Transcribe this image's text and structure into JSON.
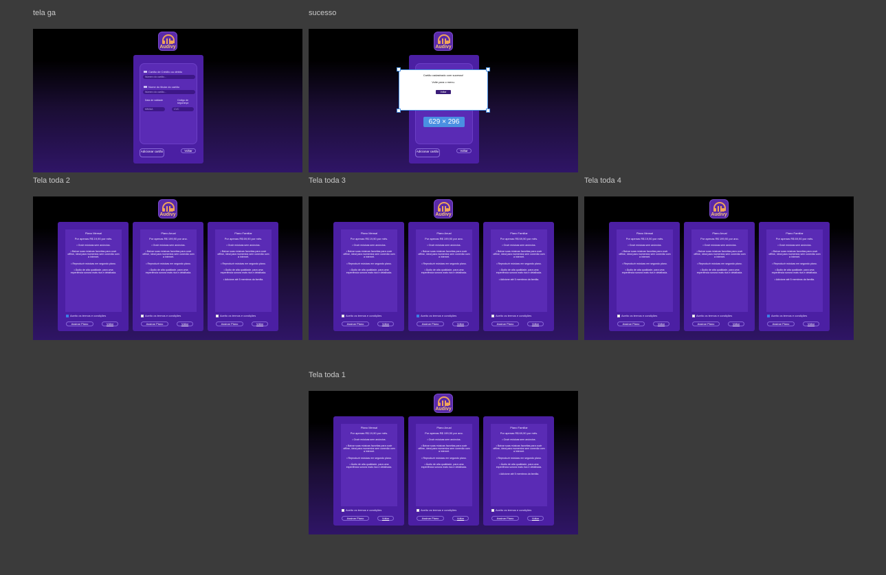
{
  "frames": {
    "tela_ga": {
      "label": "tela ga",
      "logo_text": "Audivy",
      "card_label": "Cartão de Crédito ou débito",
      "card_placeholder": "Número do cartão...",
      "holder_label": "Nome do titular do cartão",
      "holder_placeholder": "Número do cartão...",
      "expiry_label": "Data de validade",
      "expiry_placeholder": "MM/AA",
      "cvc_label": "Código de segurança",
      "cvc_placeholder": "CVC",
      "add_button": "Adicionar cartão",
      "back_button": "Voltar"
    },
    "sucesso": {
      "label": "sucesso",
      "logo_text": "Audivy",
      "modal_title": "Cartão cadastrado com sucesso!",
      "modal_subtitle": "Volte para o menu.",
      "modal_button": "Voltar",
      "size_badge": "629 × 296",
      "add_button": "Adicionar cartão",
      "back_button": "Voltar"
    },
    "plans": {
      "monthly": {
        "title": "Plano Mensal",
        "price": "Por apenas R$ 19,90 por mês.",
        "features": [
          "• Ouvir músicas sem anúncios.",
          "• Baixar suas músicas favoritas para ouvir offline, ideal para momentos sem conexão com a internet.",
          "• Reproduzir músicas em segundo plano.",
          "• Áudio de alta qualidade, para uma experiência sonora mais rica e detalhada."
        ]
      },
      "annual": {
        "title": "Plano Anual",
        "price": "Por apenas R$ 199,90 por ano.",
        "features": [
          "• Ouvir músicas sem anúncios.",
          "• Baixar suas músicas favoritas para ouvir offline, ideal para momentos sem conexão com a internet.",
          "• Reproduzir músicas em segundo plano.",
          "• Áudio de alta qualidade, para uma experiência sonora mais rica e detalhada."
        ]
      },
      "family": {
        "title": "Plano Familiar",
        "price": "Por apenas R$ 69,90 por mês.",
        "features": [
          "• Ouvir músicas sem anúncios.",
          "• Baixar suas músicas favoritas para ouvir offline, ideal para momentos sem conexão com a internet.",
          "• Reproduzir músicas em segundo plano.",
          "• Áudio de alta qualidade, para uma experiência sonora mais rica e detalhada.",
          "• Adicione até 5 membros da família."
        ]
      },
      "terms": "Aceito os termos e condições",
      "sign_button": "Assinar Plano",
      "back_button": "Voltar"
    },
    "tela_toda_2": {
      "label": "Tela toda 2",
      "logo_text": "Audivy",
      "checked": [
        true,
        false,
        false
      ]
    },
    "tela_toda_3": {
      "label": "Tela toda 3",
      "logo_text": "Audivy",
      "checked": [
        false,
        true,
        false
      ]
    },
    "tela_toda_4": {
      "label": "Tela toda 4",
      "logo_text": "Audivy",
      "checked": [
        false,
        false,
        true
      ]
    },
    "tela_toda_1": {
      "label": "Tela toda 1",
      "logo_text": "Audivy",
      "checked": [
        false,
        false,
        false
      ]
    }
  },
  "colors": {
    "canvas": "#3b3b3b",
    "card": "#4b1fa3",
    "card_inner": "#5a2bb5",
    "logo_accent": "#f0a55a",
    "selection": "#4a90e2"
  }
}
